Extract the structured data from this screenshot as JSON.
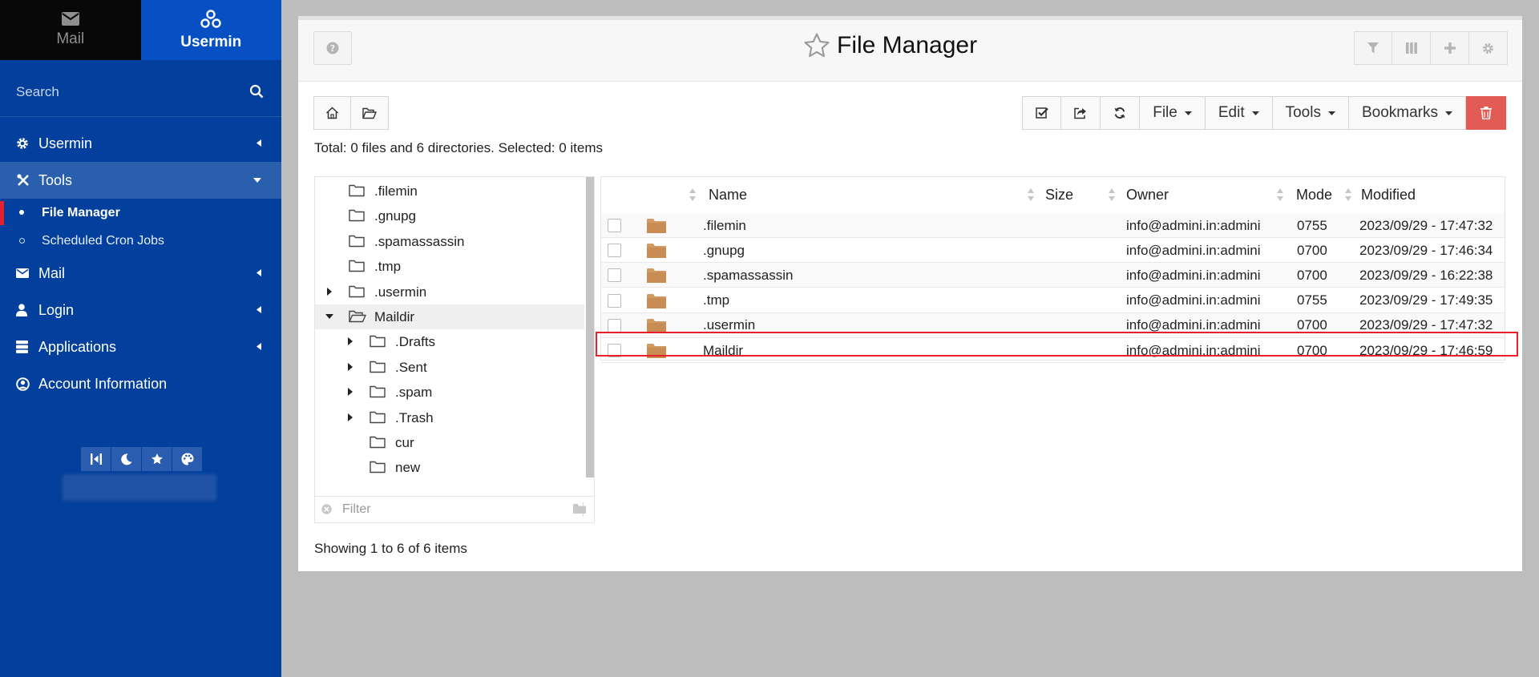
{
  "sidebar": {
    "tabs": [
      {
        "label": "Mail",
        "icon": "envelope-icon"
      },
      {
        "label": "Usermin",
        "icon": "usermin-logo-icon"
      }
    ],
    "search_placeholder": "Search",
    "menu": [
      {
        "label": "Usermin",
        "icon": "gear-icon"
      },
      {
        "label": "Tools",
        "icon": "tools-icon"
      }
    ],
    "tools_sub": [
      {
        "label": "File Manager"
      },
      {
        "label": "Scheduled Cron Jobs"
      }
    ],
    "menu2": [
      {
        "label": "Mail",
        "icon": "envelope-icon"
      },
      {
        "label": "Login",
        "icon": "user-icon"
      },
      {
        "label": "Applications",
        "icon": "server-icon"
      },
      {
        "label": "Account Information",
        "icon": "user-circle-icon"
      }
    ]
  },
  "header": {
    "title": "File Manager"
  },
  "toolbar": {
    "file": "File",
    "edit": "Edit",
    "tools": "Tools",
    "bookmarks": "Bookmarks"
  },
  "summary": {
    "total": "Total: 0 files and 6 directories. Selected: 0 items"
  },
  "tree": {
    "nodes": [
      {
        "name": ".filemin"
      },
      {
        "name": ".gnupg"
      },
      {
        "name": ".spamassassin"
      },
      {
        "name": ".tmp"
      },
      {
        "name": ".usermin"
      },
      {
        "name": "Maildir"
      },
      {
        "name": ".Drafts"
      },
      {
        "name": ".Sent"
      },
      {
        "name": ".spam"
      },
      {
        "name": ".Trash"
      },
      {
        "name": "cur"
      },
      {
        "name": "new"
      }
    ],
    "filter_placeholder": "Filter"
  },
  "table": {
    "columns": {
      "name": "Name",
      "size": "Size",
      "owner": "Owner",
      "mode": "Mode",
      "modified": "Modified"
    },
    "rows": [
      {
        "name": ".filemin",
        "size": "",
        "owner": "info@admini.in:admini",
        "mode": "0755",
        "modified": "2023/09/29 - 17:47:32"
      },
      {
        "name": ".gnupg",
        "size": "",
        "owner": "info@admini.in:admini",
        "mode": "0700",
        "modified": "2023/09/29 - 17:46:34"
      },
      {
        "name": ".spamassassin",
        "size": "",
        "owner": "info@admini.in:admini",
        "mode": "0700",
        "modified": "2023/09/29 - 16:22:38"
      },
      {
        "name": ".tmp",
        "size": "",
        "owner": "info@admini.in:admini",
        "mode": "0755",
        "modified": "2023/09/29 - 17:49:35"
      },
      {
        "name": ".usermin",
        "size": "",
        "owner": "info@admini.in:admini",
        "mode": "0700",
        "modified": "2023/09/29 - 17:47:32"
      },
      {
        "name": "Maildir",
        "size": "",
        "owner": "info@admini.in:admini",
        "mode": "0700",
        "modified": "2023/09/29 - 17:46:59"
      }
    ]
  },
  "footer": {
    "showing": "Showing 1 to 6 of 6 items"
  },
  "colors": {
    "sidebar_bg": "#033f9c",
    "sidebar_active": "#2a5fae",
    "highlight_border": "#e8202a",
    "delete_button": "#e25b55",
    "folder_icon": "#d09a63"
  }
}
